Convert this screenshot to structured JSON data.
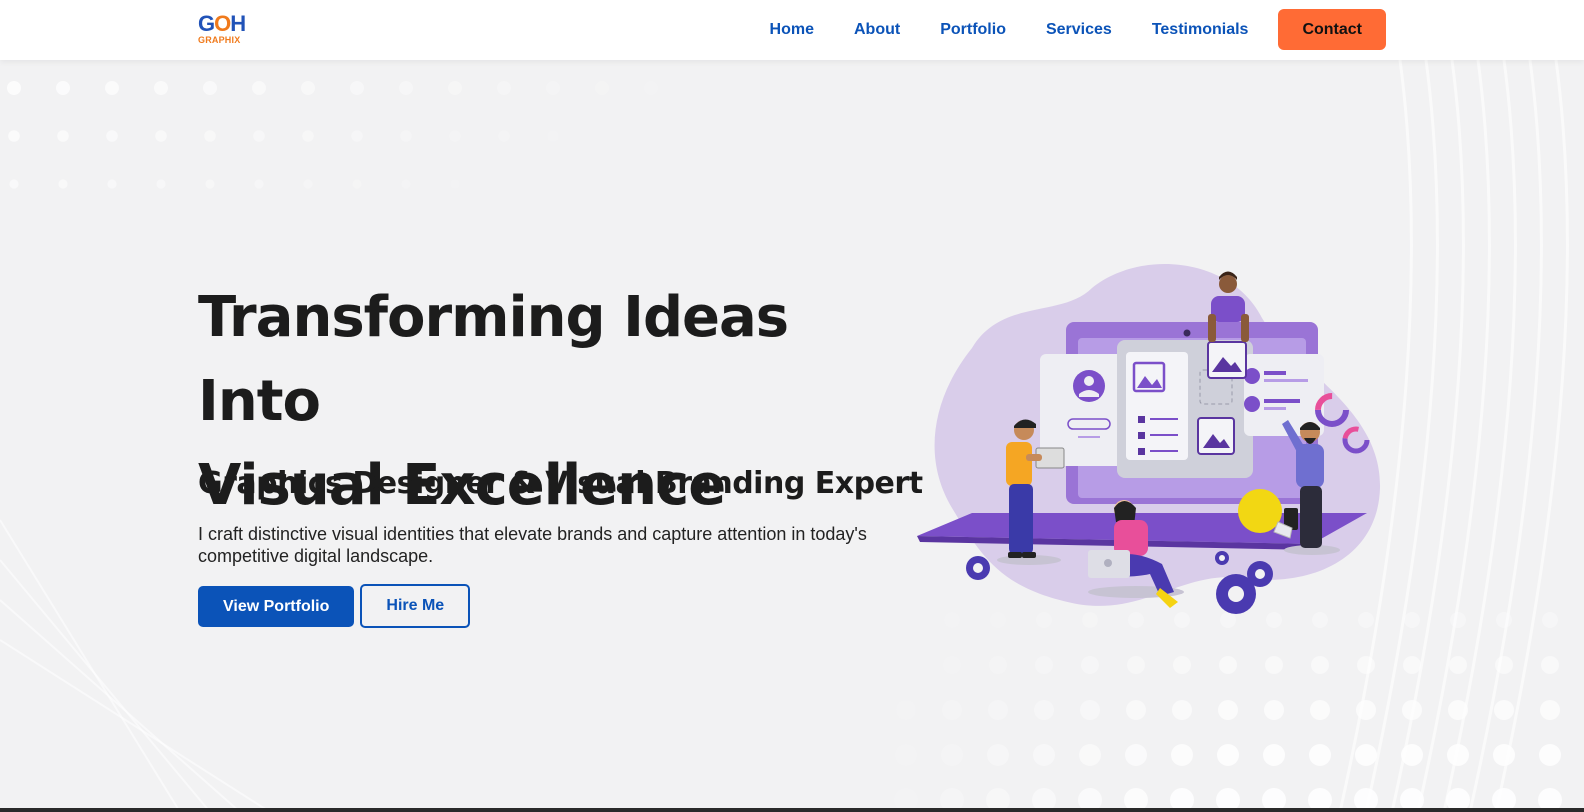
{
  "brand": {
    "logo_main": "GOH",
    "logo_sub": "GRAPHIX"
  },
  "nav": {
    "links": [
      "Home",
      "About",
      "Portfolio",
      "Services",
      "Testimonials"
    ],
    "contact_label": "Contact"
  },
  "hero": {
    "title_line1": "Transforming Ideas Into",
    "title_line2": "Visual Excellence",
    "subtitle": "Graphics Designer & Visual Branding Expert",
    "description": "I craft distinctive visual identities that elevate brands and capture attention in today's competitive digital landscape.",
    "primary_button": "View Portfolio",
    "secondary_button": "Hire Me"
  },
  "colors": {
    "accent_blue": "#0b53b8",
    "accent_orange": "#ff6b35",
    "illustration_purple": "#7b4fc9",
    "background": "#f2f2f3"
  }
}
